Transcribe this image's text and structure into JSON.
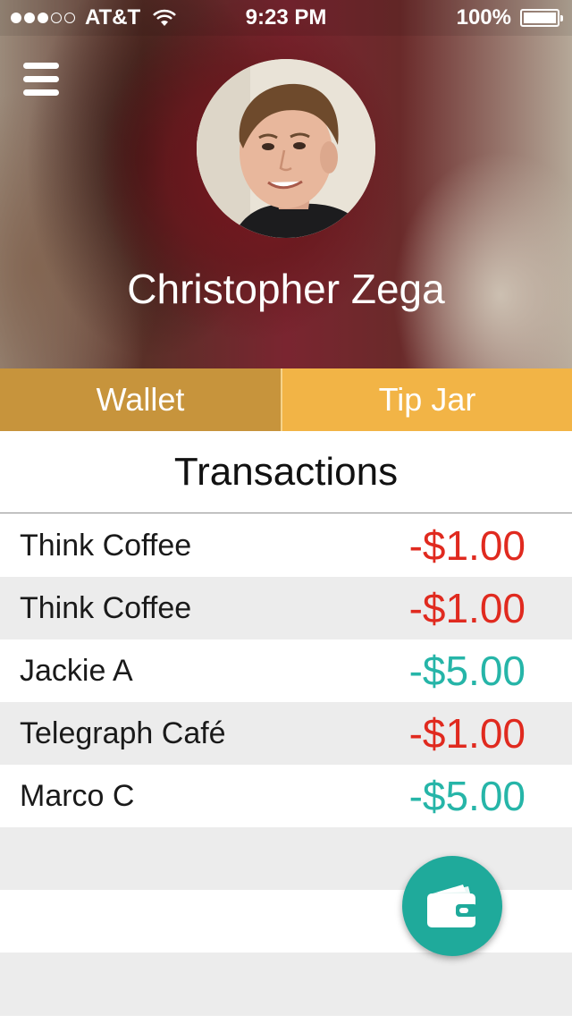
{
  "status_bar": {
    "carrier": "AT&T",
    "time": "9:23 PM",
    "battery": "100%",
    "signal_bars_filled": 3,
    "signal_bars_total": 5,
    "battery_level": 1.0
  },
  "header": {
    "menu_icon": "hamburger-menu-icon",
    "avatar_icon": "profile-photo",
    "name": "Christopher Zega"
  },
  "tabs": [
    {
      "label": "Wallet",
      "selected": true,
      "color": "#c7943c"
    },
    {
      "label": "Tip Jar",
      "selected": false,
      "color": "#f2b446"
    }
  ],
  "section_title": "Transactions",
  "transactions": [
    {
      "name": "Think Coffee",
      "amount": "-$1.00",
      "color": "#e02a1f"
    },
    {
      "name": "Think Coffee",
      "amount": "-$1.00",
      "color": "#e02a1f"
    },
    {
      "name": "Jackie A",
      "amount": "-$5.00",
      "color": "#26b5a8"
    },
    {
      "name": "Telegraph Café",
      "amount": "-$1.00",
      "color": "#e02a1f"
    },
    {
      "name": "Marco C",
      "amount": "-$5.00",
      "color": "#26b5a8"
    }
  ],
  "fab": {
    "icon": "wallet-icon",
    "color": "#1faa9b"
  }
}
